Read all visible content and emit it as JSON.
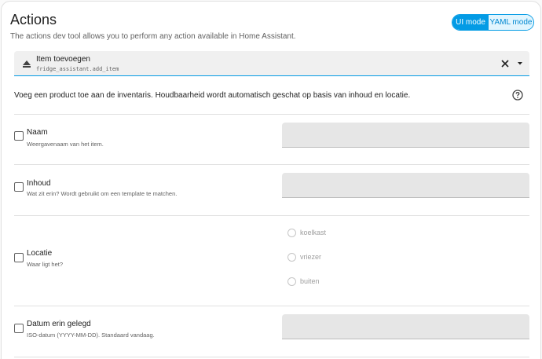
{
  "header": {
    "title": "Actions",
    "subtitle": "The actions dev tool allows you to perform any action available in Home Assistant.",
    "mode_ui": "UI mode",
    "mode_yaml": "YAML mode"
  },
  "action_selector": {
    "label": "Item toevoegen",
    "value": "fridge_assistant.add_item",
    "icon": "eject-icon"
  },
  "description": "Voeg een product toe aan de inventaris. Houdbaarheid wordt automatisch geschat op basis van inhoud en locatie.",
  "fields": [
    {
      "label": "Naam",
      "help": "Weergavenaam van het item.",
      "value": ""
    },
    {
      "label": "Inhoud",
      "help": "Wat zit erin? Wordt gebruikt om een template te matchen.",
      "value": ""
    },
    {
      "label": "Locatie",
      "help": "Waar ligt het?",
      "options": [
        "koelkast",
        "vriezer",
        "buiten"
      ]
    },
    {
      "label": "Datum erin gelegd",
      "help": "ISO-datum (YYYY-MM-DD). Standaard vandaag.",
      "value": ""
    }
  ],
  "colors": {
    "accent": "#039be5",
    "accent_light": "#e1f5fe",
    "field_bg": "#e6e6e6"
  }
}
